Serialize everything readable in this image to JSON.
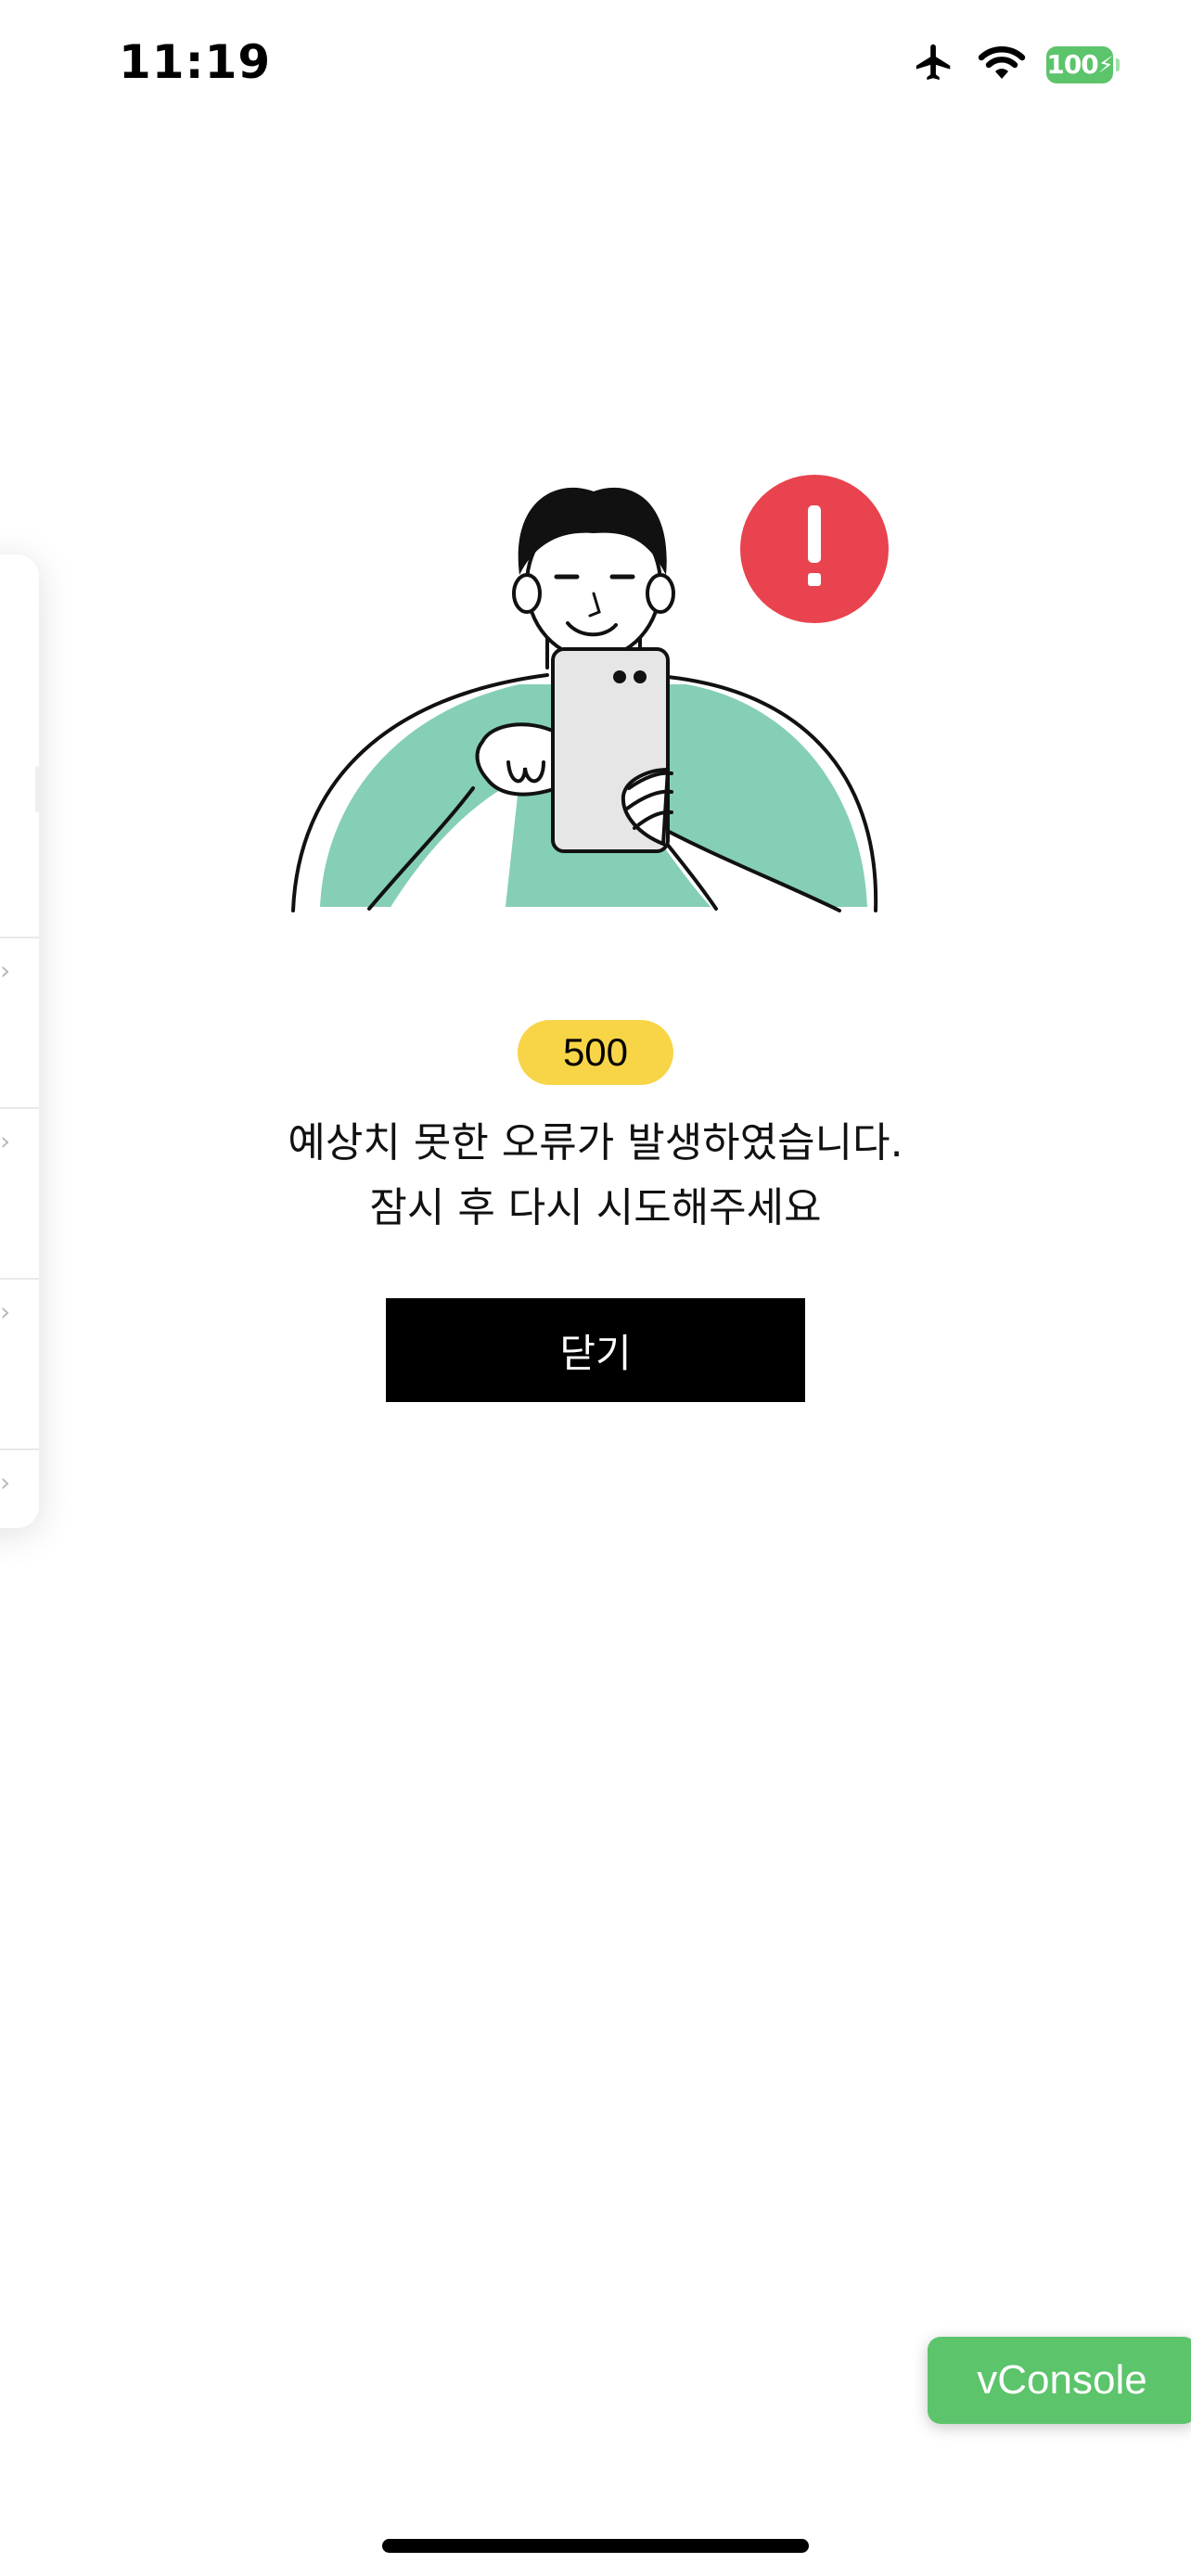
{
  "status_bar": {
    "time": "11:19",
    "battery_level": "100",
    "icons": [
      "airplane-icon",
      "wifi-icon",
      "battery-icon"
    ]
  },
  "error": {
    "code": "500",
    "message_line1": "예상치 못한 오류가 발생하였습니다.",
    "message_line2": "잠시 후 다시 시도해주세요"
  },
  "actions": {
    "close_label": "닫기"
  },
  "debug": {
    "vconsole_label": "vConsole"
  },
  "colors": {
    "badge": "#f8d447",
    "alert": "#e8434e",
    "illustration_accent": "#85cfb6",
    "vconsole": "#5cc46b",
    "button": "#000000"
  }
}
